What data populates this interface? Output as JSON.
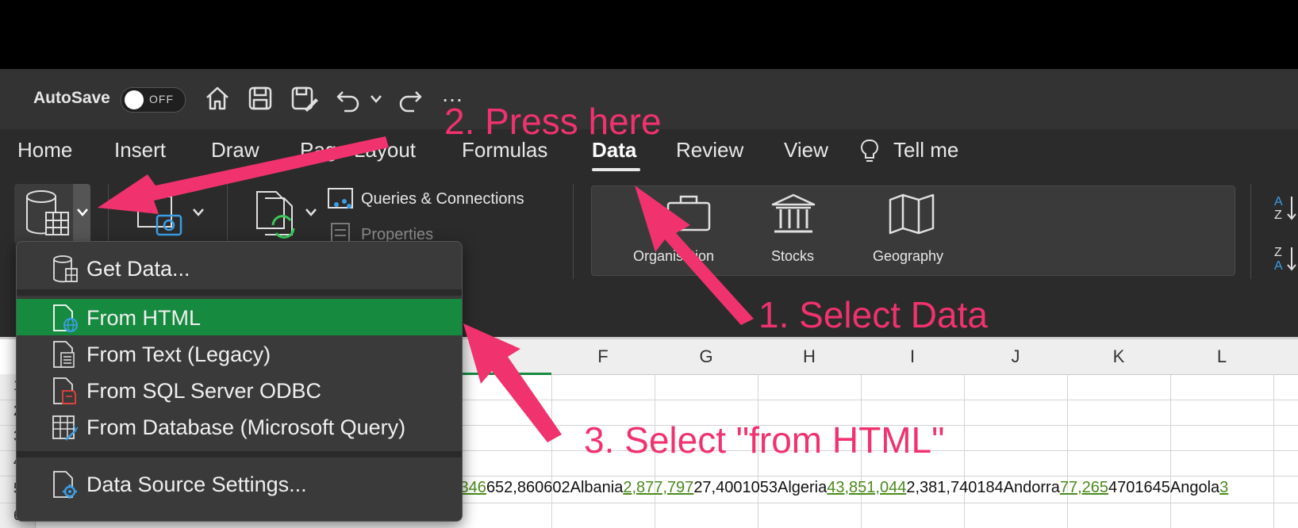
{
  "quick_access": {
    "autosave_label": "AutoSave",
    "toggle_state": "OFF",
    "more_label": "…"
  },
  "tabs": [
    {
      "label": "Home"
    },
    {
      "label": "Insert"
    },
    {
      "label": "Draw"
    },
    {
      "label": "Page Layout"
    },
    {
      "label": "Formulas"
    },
    {
      "label": "Data",
      "active": true
    },
    {
      "label": "Review"
    },
    {
      "label": "View"
    },
    {
      "label": "Tell me"
    }
  ],
  "ribbon": {
    "queries_connections": "Queries & Connections",
    "properties": "Properties",
    "data_types": [
      {
        "label": "Organisation",
        "icon": "briefcase-icon"
      },
      {
        "label": "Stocks",
        "icon": "bank-icon"
      },
      {
        "label": "Geography",
        "icon": "map-icon"
      }
    ],
    "sort_az": "A\nZ",
    "sort_za": "Z\nA"
  },
  "grid": {
    "columns": [
      "F",
      "G",
      "H",
      "I",
      "J",
      "K",
      "L"
    ],
    "row_numbers": [
      "1",
      "2",
      "3",
      "4",
      "5",
      "6"
    ],
    "row5_segments": [
      {
        "text": ",346",
        "link": true
      },
      {
        "text": "652,860602Albania",
        "link": false
      },
      {
        "text": "2,877,797",
        "link": true
      },
      {
        "text": "27,4001053Algeria",
        "link": false
      },
      {
        "text": "43,851,044",
        "link": true
      },
      {
        "text": "2,381,740184Andorra",
        "link": false
      },
      {
        "text": "77,265",
        "link": true
      },
      {
        "text": "4701645Angola",
        "link": false
      },
      {
        "text": "3",
        "link": true
      }
    ]
  },
  "menu": {
    "items": [
      {
        "label": "Get Data...",
        "icon": "database-icon"
      },
      {
        "label": "From HTML",
        "icon": "html-file-icon",
        "highlighted": true
      },
      {
        "label": "From Text (Legacy)",
        "icon": "text-file-icon"
      },
      {
        "label": "From SQL Server ODBC",
        "icon": "sql-file-icon"
      },
      {
        "label": "From Database (Microsoft Query)",
        "icon": "database-query-icon"
      },
      {
        "label": "Data Source Settings...",
        "icon": "settings-file-icon"
      }
    ]
  },
  "annotations": {
    "step1": "1. Select Data",
    "step2": "2. Press here",
    "step3": "3. Select \"from HTML\""
  },
  "colors": {
    "annotation": "#f0326e",
    "highlight": "#168a3f",
    "link": "#4a8a1c"
  }
}
